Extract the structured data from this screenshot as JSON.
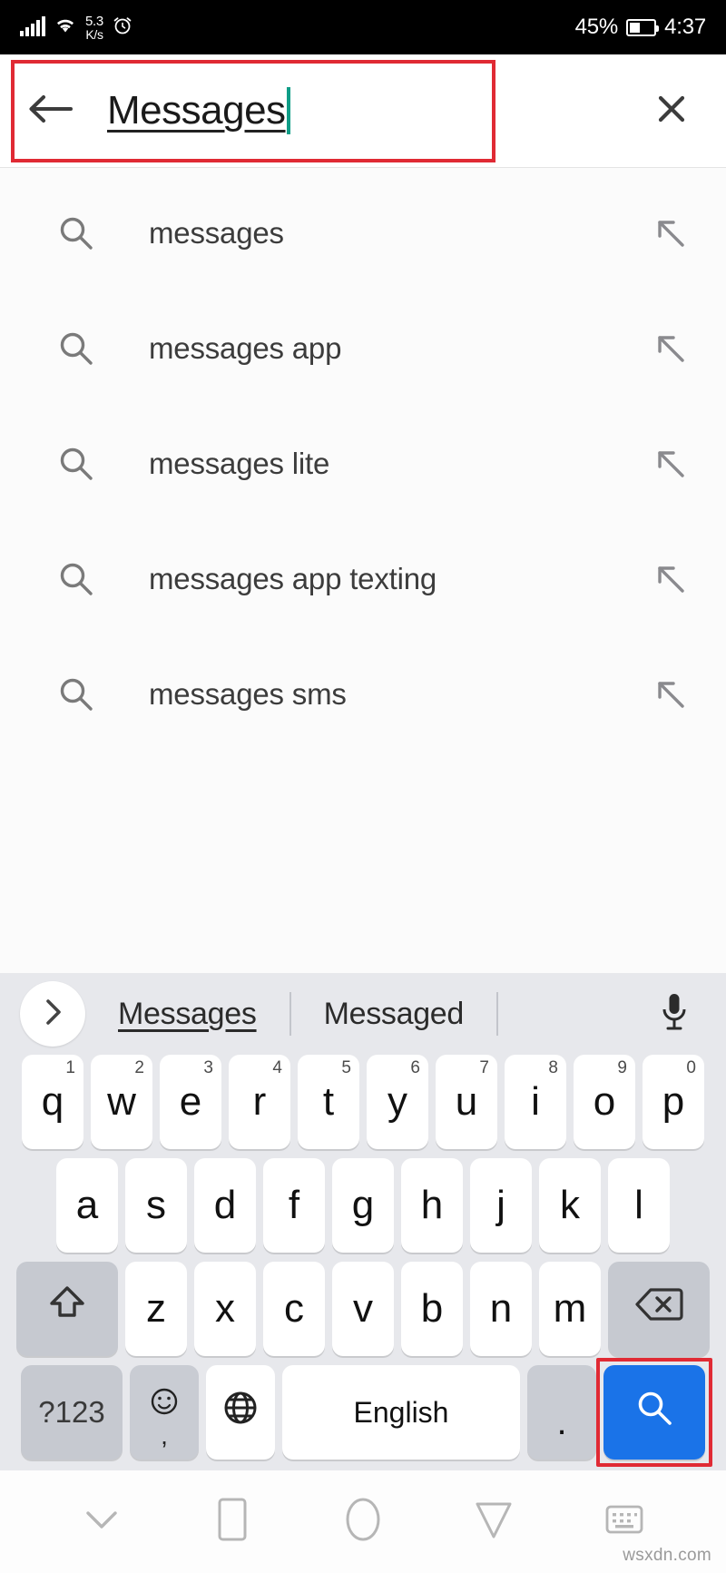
{
  "status_bar": {
    "network_speed_value": "5.3",
    "network_speed_unit": "K/s",
    "battery_percent": "45%",
    "time": "4:37",
    "icons": [
      "signal-bars-icon",
      "wifi-icon",
      "alarm-clock-icon",
      "battery-icon"
    ]
  },
  "search_bar": {
    "back_icon": "back-arrow-icon",
    "query": "Messages",
    "clear_icon": "close-x-icon",
    "caret_color": "#0f9d87",
    "annotation_color": "#e02a34"
  },
  "suggestions": {
    "left_icon": "search-magnifier-icon",
    "right_icon": "arrow-up-left-insert-icon",
    "items": [
      {
        "label": "messages"
      },
      {
        "label": "messages app"
      },
      {
        "label": "messages lite"
      },
      {
        "label": "messages app texting"
      },
      {
        "label": "messages sms"
      }
    ]
  },
  "keyboard": {
    "suggestion_strip": {
      "expand_icon": "chevron-right-icon",
      "words": [
        "Messages",
        "Messaged"
      ],
      "active_word_index": 0,
      "mic_icon": "microphone-icon"
    },
    "row1": [
      {
        "key": "q",
        "num": "1"
      },
      {
        "key": "w",
        "num": "2"
      },
      {
        "key": "e",
        "num": "3"
      },
      {
        "key": "r",
        "num": "4"
      },
      {
        "key": "t",
        "num": "5"
      },
      {
        "key": "y",
        "num": "6"
      },
      {
        "key": "u",
        "num": "7"
      },
      {
        "key": "i",
        "num": "8"
      },
      {
        "key": "o",
        "num": "9"
      },
      {
        "key": "p",
        "num": "0"
      }
    ],
    "row2": [
      {
        "key": "a"
      },
      {
        "key": "s"
      },
      {
        "key": "d"
      },
      {
        "key": "f"
      },
      {
        "key": "g"
      },
      {
        "key": "h"
      },
      {
        "key": "j"
      },
      {
        "key": "k"
      },
      {
        "key": "l"
      }
    ],
    "row3": {
      "shift_icon": "shift-arrow-up-icon",
      "letters": [
        {
          "key": "z"
        },
        {
          "key": "x"
        },
        {
          "key": "c"
        },
        {
          "key": "v"
        },
        {
          "key": "b"
        },
        {
          "key": "n"
        },
        {
          "key": "m"
        }
      ],
      "backspace_icon": "backspace-delete-icon"
    },
    "row4": {
      "symbols_label": "?123",
      "emoji_icon": "emoji-smiley-icon",
      "emoji_secondary": ",",
      "globe_icon": "globe-language-icon",
      "space_label": "English",
      "period_label": ".",
      "enter_icon": "search-magnifier-icon",
      "enter_color": "#1a73e8",
      "enter_annotation_color": "#e02a34"
    }
  },
  "nav_bar": {
    "items": [
      {
        "icon": "chevron-down-hide-keyboard-icon"
      },
      {
        "icon": "square-recents-icon"
      },
      {
        "icon": "circle-home-icon"
      },
      {
        "icon": "triangle-down-back-icon"
      },
      {
        "icon": "keyboard-switch-icon"
      }
    ]
  },
  "watermark": {
    "text": "wsxdn.com"
  }
}
